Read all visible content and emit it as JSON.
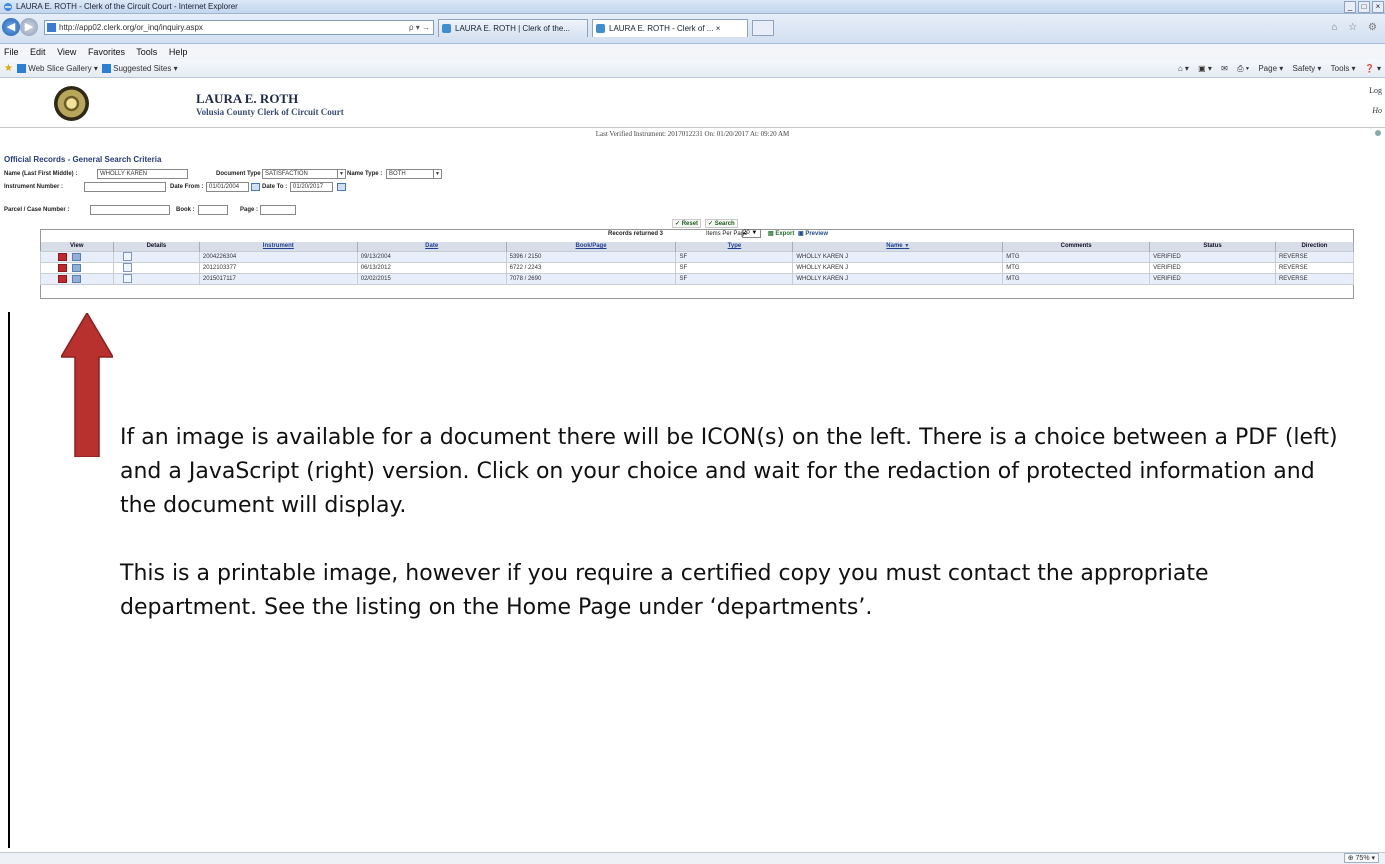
{
  "window": {
    "title": "LAURA E. ROTH - Clerk of the Circuit Court - Internet Explorer",
    "controls": [
      "_",
      "□",
      "×"
    ]
  },
  "browser": {
    "url": "http://app02.clerk.org/or_inq/inquiry.aspx",
    "url_controls": "ρ ▾ →",
    "tabs": [
      {
        "label": "LAURA E. ROTH | Clerk of the..."
      },
      {
        "label": "LAURA E. ROTH - Clerk of ... ×"
      }
    ],
    "right_controls": "⌂ ☆ ⚙",
    "menu": [
      "File",
      "Edit",
      "View",
      "Favorites",
      "Tools",
      "Help"
    ],
    "favorites": [
      "Web Slice Gallery ▾",
      "Suggested Sites ▾"
    ],
    "command_bar": [
      "⌂ ▾",
      "▣ ▾",
      "✉",
      "⎙ ▾",
      "Page ▾",
      "Safety ▾",
      "Tools ▾",
      "❓ ▾"
    ],
    "zoom": "⊕ 75% ▾"
  },
  "header": {
    "clerk_name": "LAURA E. ROTH",
    "clerk_office": "Volusia County Clerk of Circuit Court",
    "logout": "Log",
    "home": "Ho"
  },
  "verified_line": "Last Verified Instrument: 2017012231 On: 01/20/2017 At: 09:20 AM",
  "search": {
    "title": "Official Records - General Search Criteria",
    "name_label": "Name (Last First Middle) :",
    "name_value": "WHOLLY KAREN",
    "doc_type_label": "Document Type :",
    "doc_type_value": "SATISFACTION",
    "name_type_label": "Name Type :",
    "name_type_value": "BOTH",
    "instrument_label": "Instrument Number :",
    "date_from_label": "Date From :",
    "date_from_value": "01/01/2004",
    "date_to_label": "Date To :",
    "date_to_value": "01/20/2017",
    "parcel_label": "Parcel / Case Number :",
    "book_label": "Book :",
    "page_label": "Page :",
    "reset": "Reset",
    "search": "Search"
  },
  "results": {
    "records_returned": "Records returned 3",
    "items_per_page_label": "Items Per Page",
    "items_per_page_value": "20",
    "export": "Export",
    "preview": "Preview",
    "columns": [
      "View",
      "Details",
      "Instrument",
      "Date",
      "Book/Page",
      "Type",
      "Name",
      "Comments",
      "Status",
      "Direction"
    ],
    "rows": [
      {
        "instrument": "2004226304",
        "date": "09/13/2004",
        "bookpage": "5396 / 2150",
        "type": "SF",
        "name": "WHOLLY KAREN J",
        "comments": "MTG",
        "status": "VERIFIED",
        "direction": "REVERSE"
      },
      {
        "instrument": "2012103377",
        "date": "06/13/2012",
        "bookpage": "6722 / 2243",
        "type": "SF",
        "name": "WHOLLY KAREN J",
        "comments": "MTG",
        "status": "VERIFIED",
        "direction": "REVERSE"
      },
      {
        "instrument": "2015017117",
        "date": "02/02/2015",
        "bookpage": "7078 / 2690",
        "type": "SF",
        "name": "WHOLLY KAREN J",
        "comments": "MTG",
        "status": "VERIFIED",
        "direction": "REVERSE"
      }
    ]
  },
  "instructions": {
    "para1": "If an image is available for a document there will be ICON(s) on the left. There is a choice between a PDF (left) and a JavaScript (right) version.  Click on your choice and wait for the redaction of protected information and the document will display.",
    "para2": "This is a printable image, however if you require a certified copy you must contact the appropriate department. See the listing on the Home Page under ‘departments’."
  },
  "colors": {
    "arrow": "#b8312f",
    "link": "#1f3e8f",
    "alt_row": "#e9effa"
  }
}
